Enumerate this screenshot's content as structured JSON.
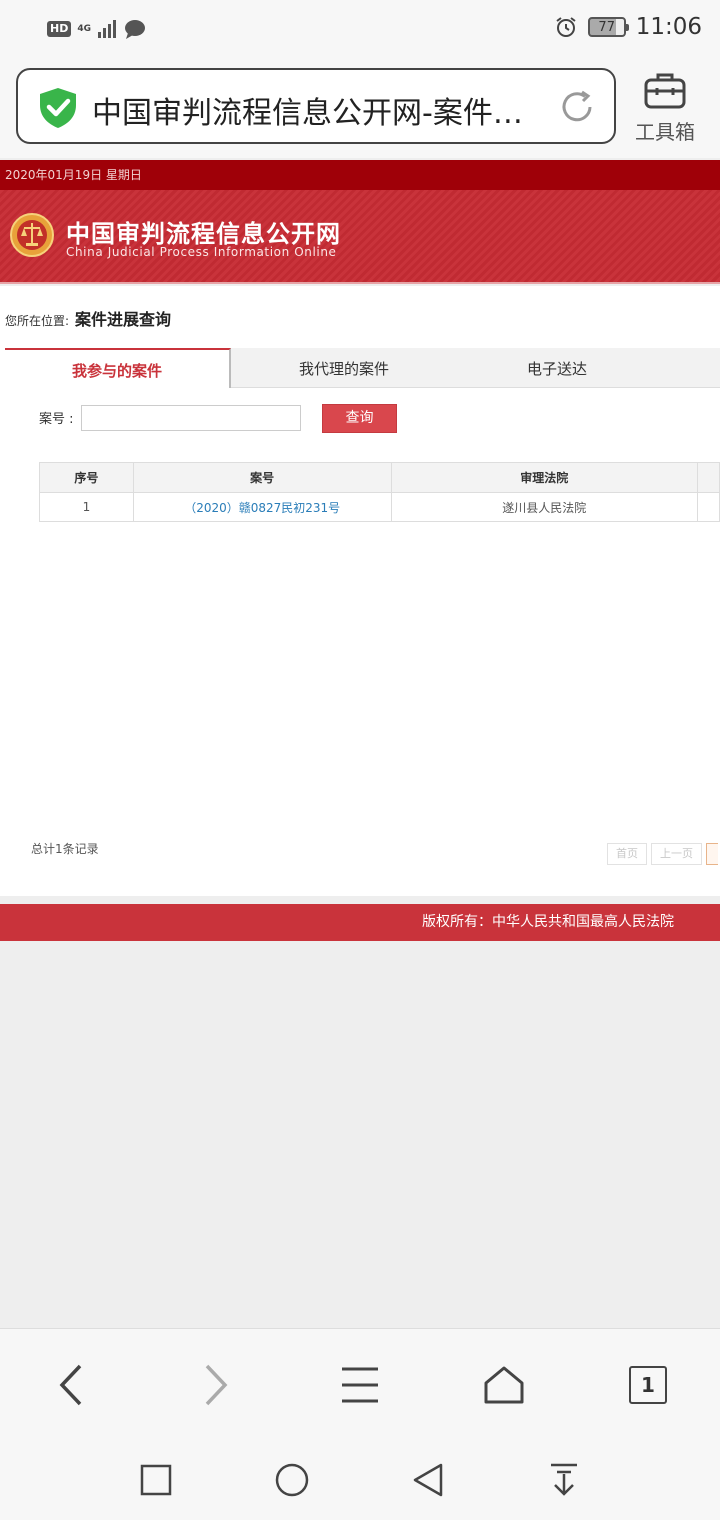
{
  "status_bar": {
    "hd_badge": "HD",
    "network": "4G",
    "battery": "77",
    "time": "11:06",
    "icons": [
      "signal-icon",
      "message-bubble-icon",
      "alarm-icon",
      "battery-icon"
    ]
  },
  "browser": {
    "url_title": "中国审判流程信息公开网-案件进展查询",
    "toolbox_label": "工具箱",
    "icons": [
      "shield-check-icon",
      "reload-icon",
      "toolbox-icon"
    ]
  },
  "site": {
    "date_line": "2020年01月19日 星期日",
    "title_cn": "中国审判流程信息公开网",
    "title_en": "China Judicial Process Information Online",
    "breadcrumb_prefix": "您所在位置:",
    "breadcrumb_current": "案件进展查询",
    "tabs": [
      {
        "label": "我参与的案件",
        "active": true
      },
      {
        "label": "我代理的案件",
        "active": false
      },
      {
        "label": "电子送达",
        "active": false
      }
    ],
    "search": {
      "label": "案号 :",
      "value": "",
      "button": "查询"
    },
    "table": {
      "columns": [
        "序号",
        "案号",
        "审理法院"
      ],
      "rows": [
        {
          "index": "1",
          "case_no": "（2020）赣0827民初231号",
          "court": "遂川县人民法院"
        }
      ]
    },
    "total_text": "总计1条记录",
    "pager": {
      "first": "首页",
      "prev": "上一页"
    },
    "footer": "版权所有：中华人民共和国最高人民法院"
  },
  "bottom_nav": {
    "tab_count": "1",
    "icons": [
      "back-arrow-icon",
      "forward-arrow-icon",
      "menu-icon",
      "home-icon",
      "tabs-icon"
    ]
  },
  "system_nav": {
    "icons": [
      "recent-apps-icon",
      "home-circle-icon",
      "back-triangle-icon",
      "notification-pull-icon"
    ]
  },
  "colors": {
    "brand_red": "#c9333b",
    "date_bar": "#9f0008",
    "link_blue": "#2a7db8",
    "shield_green": "#39b54a"
  }
}
